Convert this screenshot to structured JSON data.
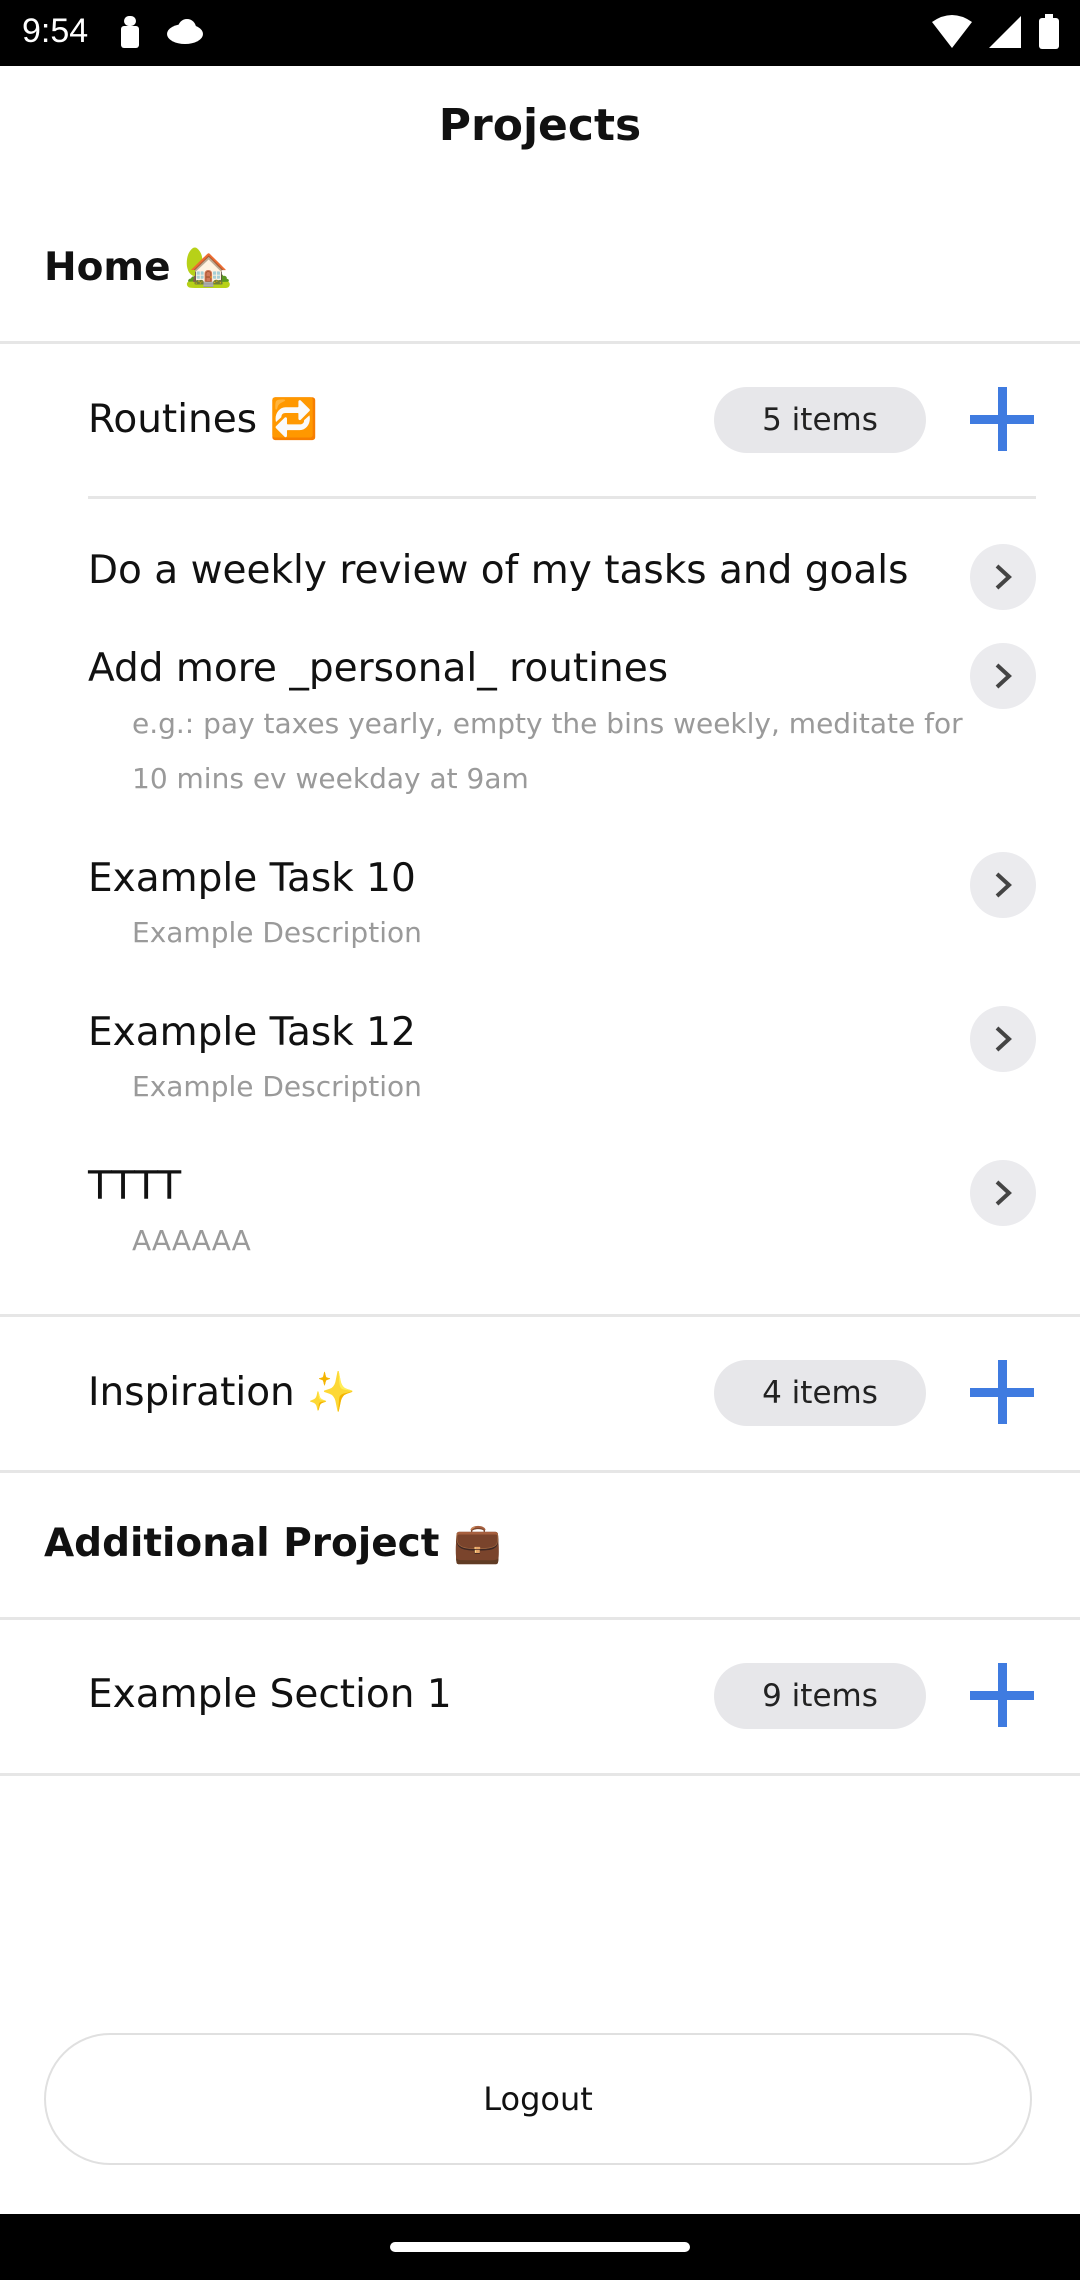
{
  "status_bar": {
    "time": "9:54"
  },
  "page": {
    "title": "Projects"
  },
  "projects": [
    {
      "name": "Home 🏡",
      "sections": [
        {
          "name": "Routines 🔁",
          "count_label": "5 items",
          "tasks": [
            {
              "title": "Do a weekly review of my tasks and goals",
              "description": ""
            },
            {
              "title": "Add more _personal_ routines",
              "description": "e.g.: pay taxes yearly, empty the bins weekly, meditate for 10 mins ev weekday at 9am"
            },
            {
              "title": "Example Task 10",
              "description": "Example Description"
            },
            {
              "title": "Example Task 12",
              "description": "Example Description"
            },
            {
              "title": "TTTT",
              "description": "AAAAAA"
            }
          ]
        },
        {
          "name": "Inspiration ✨",
          "count_label": "4 items"
        }
      ]
    },
    {
      "name": "Additional Project 💼",
      "sections": [
        {
          "name": "Example Section 1",
          "count_label": "9 items"
        }
      ]
    }
  ],
  "actions": {
    "logout_label": "Logout"
  },
  "colors": {
    "accent": "#3f7be0",
    "pill_bg": "#e7e7ea",
    "muted_text": "#9a9a9a"
  }
}
